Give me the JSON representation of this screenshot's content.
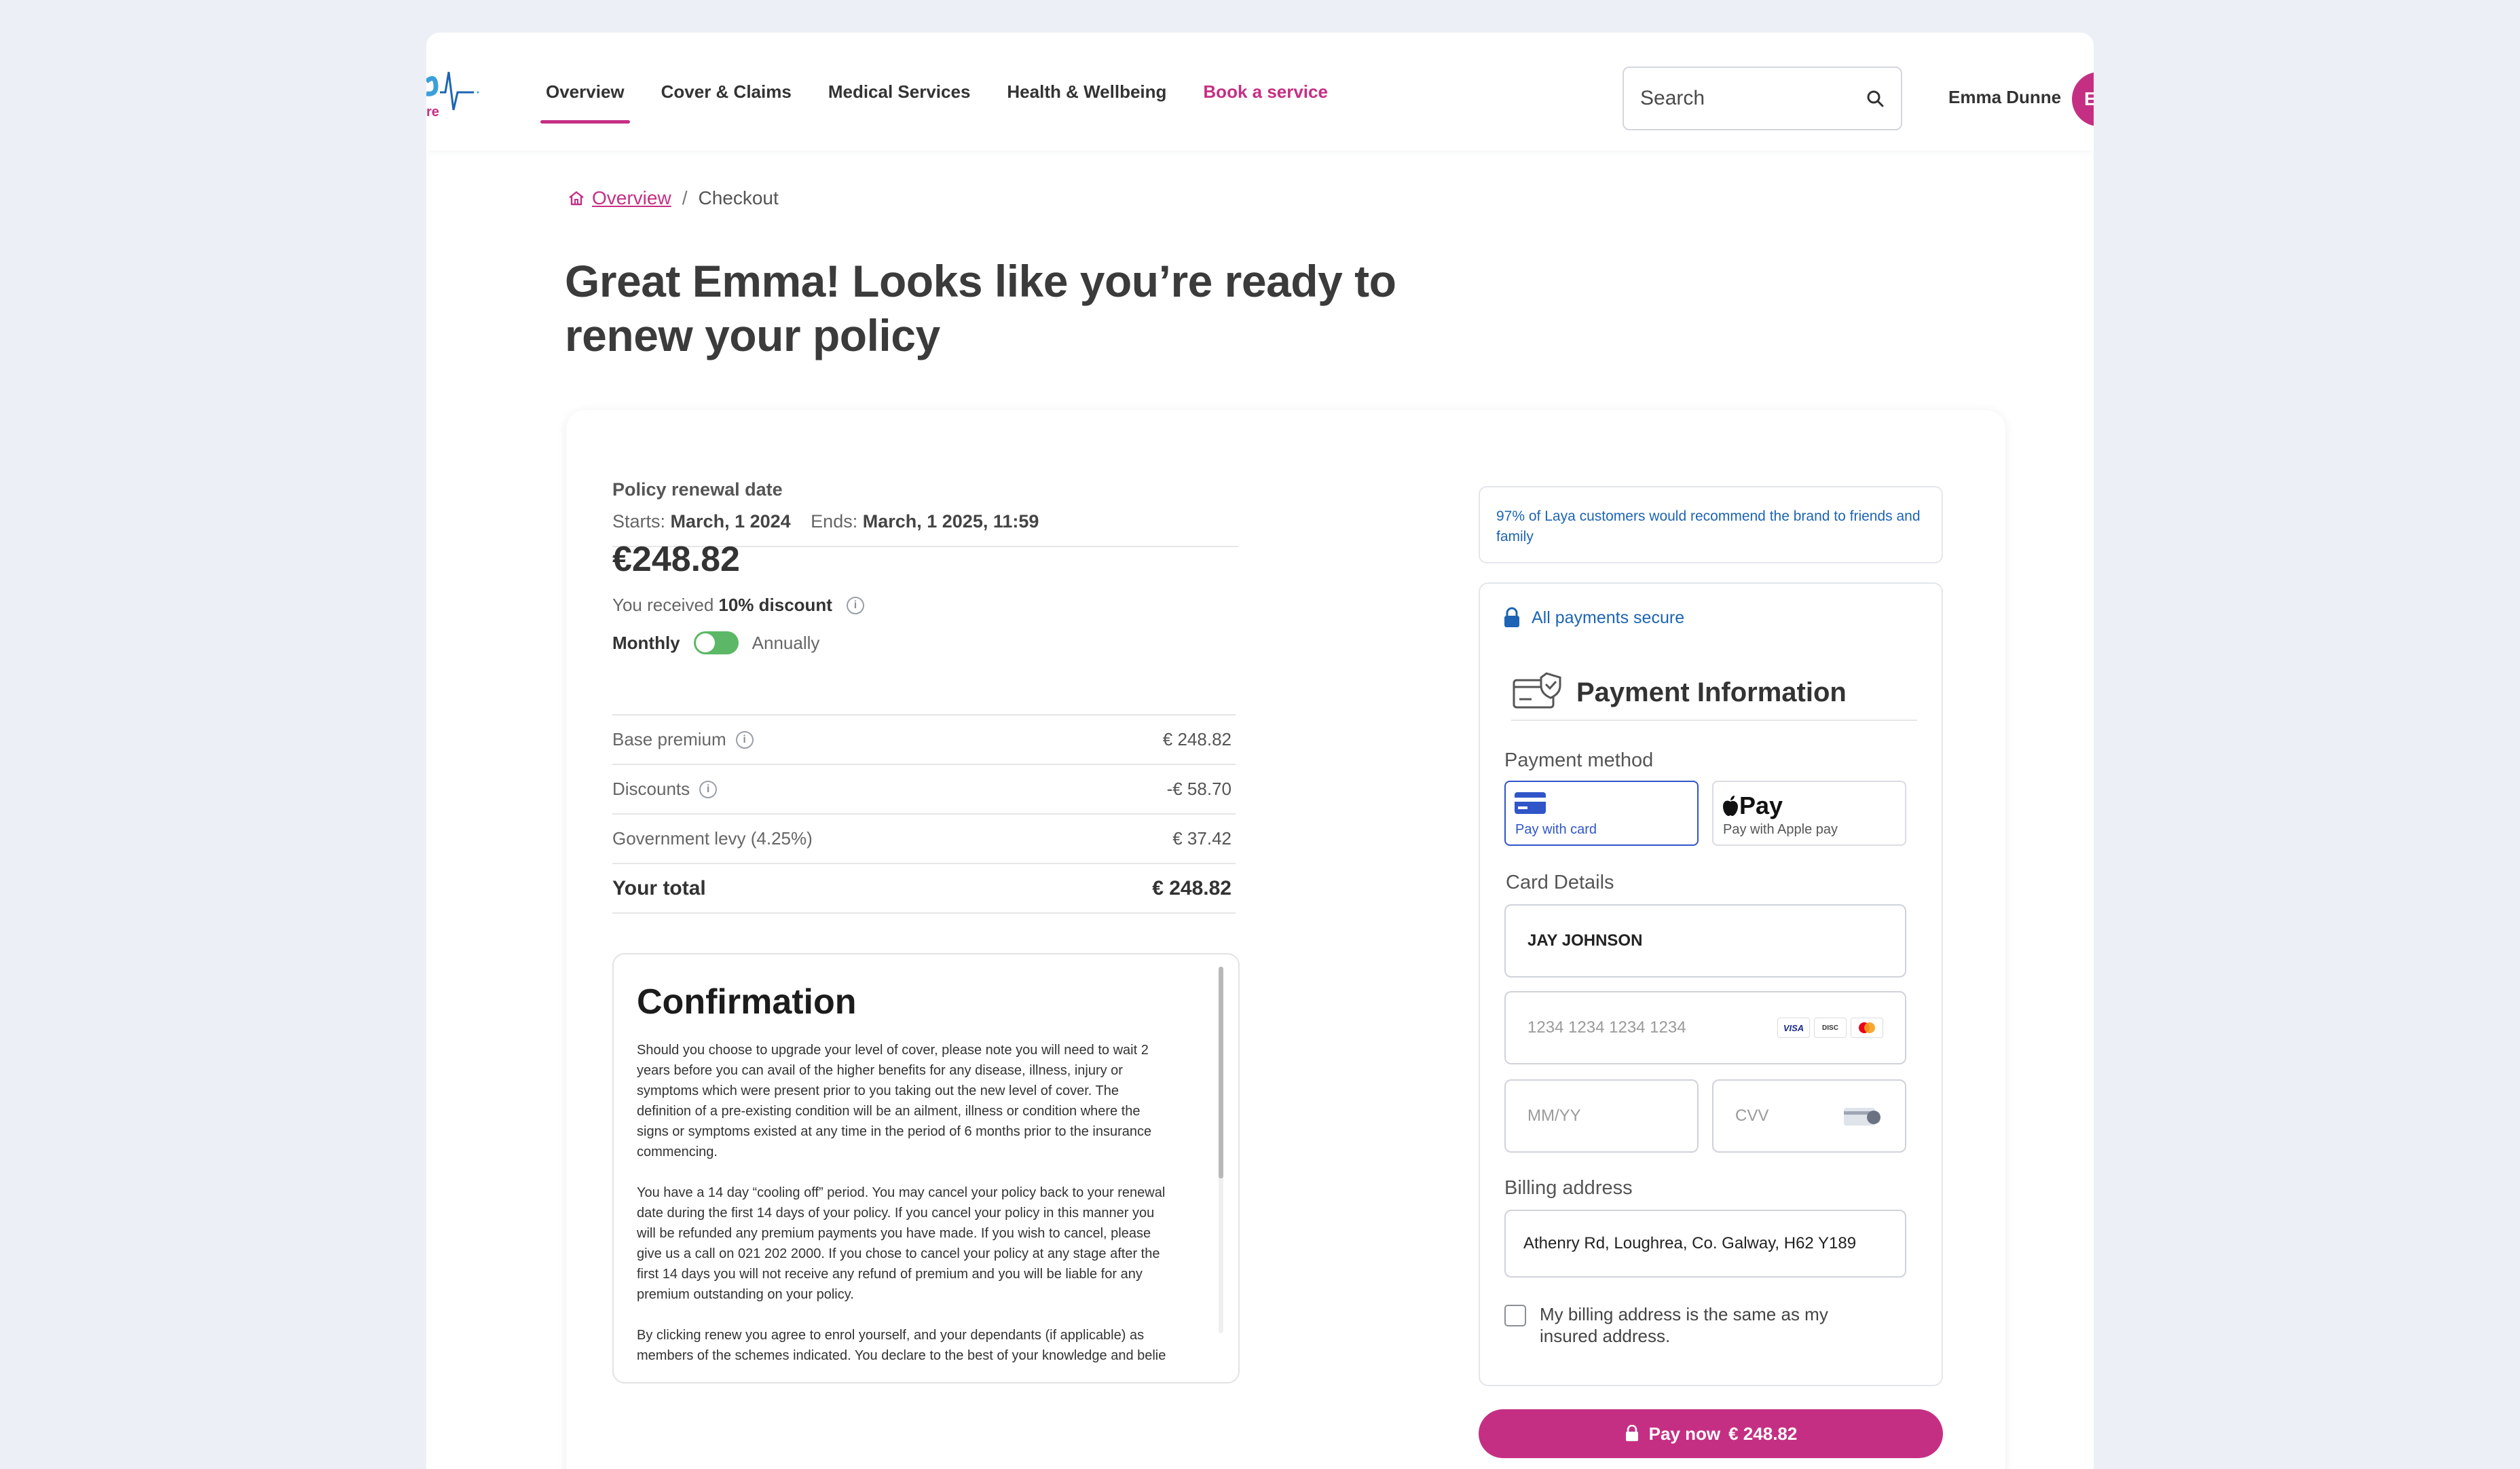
{
  "header": {
    "logo_text": "re",
    "nav": [
      {
        "label": "Overview"
      },
      {
        "label": "Cover & Claims"
      },
      {
        "label": "Medical Services"
      },
      {
        "label": "Health & Wellbeing"
      },
      {
        "label": "Book a service"
      }
    ],
    "search": {
      "placeholder": "Search"
    },
    "user": {
      "name": "Emma Dunne",
      "avatar_initial": "E"
    }
  },
  "breadcrumb": {
    "home_label": "Overview",
    "separator": "/",
    "current": "Checkout"
  },
  "page_title": "Great Emma! Looks like you’re ready to renew your policy",
  "policy": {
    "renewal_title": "Policy renewal date",
    "starts_label": "Starts:",
    "starts_value": "March, 1 2024",
    "ends_label": "Ends:",
    "ends_value": "March, 1 2025, 11:59",
    "price": "€248.82",
    "discount_prefix": "You received",
    "discount_value": "10% discount",
    "toggle_monthly": "Monthly",
    "toggle_annually": "Annually",
    "toggle_state": "Monthly",
    "breakdown": [
      {
        "label": "Base premium",
        "value": "€ 248.82"
      },
      {
        "label": "Discounts",
        "value": "-€ 58.70"
      },
      {
        "label": "Government levy (4.25%)",
        "value": "€ 37.42"
      }
    ],
    "total_label": "Your total",
    "total_value": "€ 248.82"
  },
  "confirmation": {
    "title": "Confirmation",
    "paragraphs": [
      "Should you choose to upgrade your level of cover, please note you will need to wait 2\nyears before you can avail of the higher benefits for any disease, illness, injury or\nsymptoms which were present prior to you taking out the new level of cover. The\ndefinition of a pre-existing condition will be an ailment, illness or condition where the\nsigns or symptoms existed at any time in the period of 6 months prior to the insurance\ncommencing.",
      "You have a 14 day “cooling off” period. You may cancel your policy back to your renewal\ndate during the first 14 days of your policy. If you cancel your policy in this manner you\nwill be refunded any premium payments you have made. If you wish to cancel, please\ngive us a call on 021 202 2000. If you chose to cancel your policy at any stage after the\nfirst 14 days you will not receive any refund of premium and you will be liable for any\npremium outstanding on your policy.",
      "By clicking renew you agree to enrol yourself, and your dependants (if applicable) as\nmembers of the schemes indicated. You declare to the best of your knowledge and belie"
    ],
    "scroll_position": 0.0
  },
  "trust_note": "97% of Laya customers would recommend the brand to friends and family",
  "payment": {
    "secure_label": "All payments secure",
    "title": "Payment Information",
    "method_label": "Payment method",
    "methods": [
      {
        "label": "Pay with card",
        "selected": true
      },
      {
        "label": "Pay with Apple pay",
        "brand": "Pay",
        "selected": false
      }
    ],
    "card_details_label": "Card Details",
    "card_name_value": "JAY JOHNSON",
    "card_number_placeholder": "1234 1234 1234 1234",
    "card_brands": [
      "VISA",
      "DISCOVER",
      "mastercard"
    ],
    "expiry_placeholder": "MM/YY",
    "cvv_placeholder": "CVV",
    "billing_label": "Billing address",
    "billing_value": "Athenry Rd, Loughrea, Co. Galway, H62 Y189",
    "same_address_label": "My billing address is the same as my insured address.",
    "same_address_checked": false,
    "pay_button_prefix": "Pay now",
    "pay_button_amount": "€ 248.82"
  },
  "colors": {
    "accent": "#c52f83",
    "link_blue": "#1d64b4",
    "selected_blue": "#2f55c9",
    "toggle_green": "#5cb866"
  }
}
